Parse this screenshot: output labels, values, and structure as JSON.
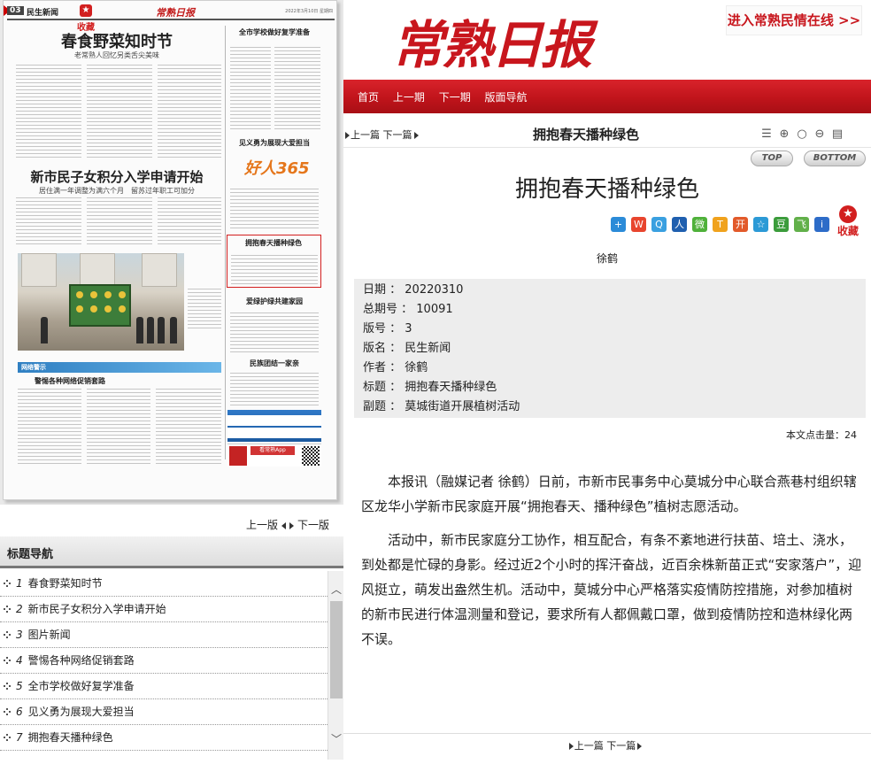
{
  "newspaper_page": {
    "page_number": "03",
    "section": "民生新闻",
    "logo": "常熟日报",
    "date_line": "2022年3月10日 星期四",
    "favorite_label": "收藏",
    "headline1": "春食野菜知时节",
    "subhead1": "老常熟人回忆另类舌尖美味",
    "headline2": "新市民子女积分入学申请开始",
    "subhead2": "居住满一年调整为满六个月　留苏过年职工可加分",
    "right_heads": [
      "全市学校做好复学准备",
      "见义勇为展现大爱担当",
      "拥抱春天播种绿色",
      "爱绿护绿共建家园",
      "民族团结一家亲"
    ],
    "ad_big": "好人365",
    "ad_app": "看常熟App",
    "band": "网络警示",
    "band_head": "警惕各种网络促销套路"
  },
  "left_pager": {
    "prev": "上一版",
    "next": "下一版"
  },
  "nav": {
    "header": "标题导航",
    "items": [
      {
        "num": "1",
        "title": "春食野菜知时节"
      },
      {
        "num": "2",
        "title": "新市民子女积分入学申请开始"
      },
      {
        "num": "3",
        "title": "图片新闻"
      },
      {
        "num": "4",
        "title": "警惕各种网络促销套路"
      },
      {
        "num": "5",
        "title": "全市学校做好复学准备"
      },
      {
        "num": "6",
        "title": "见义勇为展现大爱担当"
      },
      {
        "num": "7",
        "title": "拥抱春天播种绿色"
      }
    ]
  },
  "masthead": {
    "logo": "常熟日报",
    "minqing_link": "进入常熟民情在线 >>"
  },
  "red_nav": [
    "首页",
    "上一期",
    "下一期",
    "版面导航"
  ],
  "toolbar": {
    "prev": "上一篇",
    "next": "下一篇",
    "title": "拥抱春天播种绿色"
  },
  "top_label": "TOP",
  "bottom_label": "BOTTOM",
  "article": {
    "title": "拥抱春天播种绿色",
    "byline": "徐鹤",
    "favorite_label": "收藏",
    "meta": [
      {
        "key": "日期",
        "value": "20220310"
      },
      {
        "key": "总期号",
        "value": "10091"
      },
      {
        "key": "版号",
        "value": "3"
      },
      {
        "key": "版名",
        "value": "民生新闻"
      },
      {
        "key": "作者",
        "value": "徐鹤"
      },
      {
        "key": "标题",
        "value": "拥抱春天播种绿色"
      },
      {
        "key": "副题",
        "value": "莫城街道开展植树活动"
      }
    ],
    "clicks_label": "本文点击量：",
    "clicks_value": "24",
    "paragraphs": [
      "本报讯（融媒记者 徐鹤）日前，市新市民事务中心莫城分中心联合燕巷村组织辖区龙华小学新市民家庭开展“拥抱春天、播种绿色”植树志愿活动。",
      "活动中，新市民家庭分工协作，相互配合，有条不紊地进行扶苗、培土、浇水，到处都是忙碌的身影。经过近2个小时的挥汗奋战，近百余株新苗正式“安家落户”，迎风挺立，萌发出盎然生机。活动中，莫城分中心严格落实疫情防控措施，对参加植树的新市民进行体温测量和登记，要求所有人都佩戴口罩，做到疫情防控和造林绿化两不误。"
    ]
  },
  "bottom_pager": {
    "prev": "上一篇",
    "next": "下一篇"
  },
  "colors": {
    "brand_red": "#c8161d",
    "redbar": "#c0141b",
    "meta_bg": "#ededed"
  }
}
